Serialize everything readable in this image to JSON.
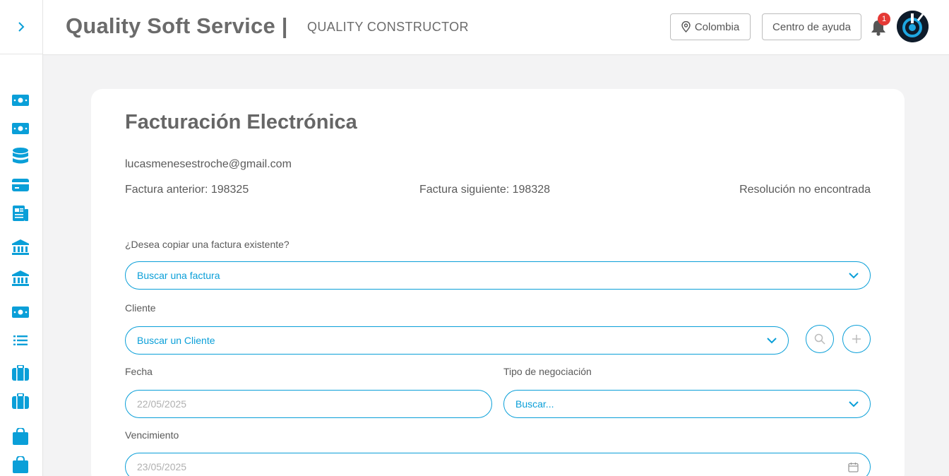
{
  "header": {
    "brand": "Quality Soft Service |",
    "subtitle": "QUALITY CONSTRUCTOR",
    "country_button": "Colombia",
    "help_button": "Centro de ayuda",
    "notification_count": "1"
  },
  "sidebar": {
    "icons": [
      "money-icon",
      "money-icon",
      "database-icon",
      "credit-card-icon",
      "newspaper-icon",
      "bank-icon",
      "bank-icon",
      "money-icon",
      "list-icon",
      "briefcase-icon",
      "briefcase-icon",
      "shopping-bag-icon",
      "shopping-bag-icon"
    ]
  },
  "main": {
    "title": "Facturación Electrónica",
    "email": "lucasmenesestroche@gmail.com",
    "prev_invoice": "Factura anterior: 198325",
    "next_invoice": "Factura siguiente: 198328",
    "resolution": "Resolución no encontrada",
    "copy_question": "¿Desea copiar una factura existente?",
    "invoice_search": "Buscar una factura",
    "client_label": "Cliente",
    "client_search": "Buscar un Cliente",
    "date_label": "Fecha",
    "date_value": "22/05/2025",
    "negotiation_label": "Tipo de negociación",
    "negotiation_search": "Buscar...",
    "due_label": "Vencimiento",
    "due_value": "23/05/2025"
  },
  "colors": {
    "accent": "#0a9fd8",
    "badge": "#e53935",
    "text": "#5a5a5a"
  }
}
